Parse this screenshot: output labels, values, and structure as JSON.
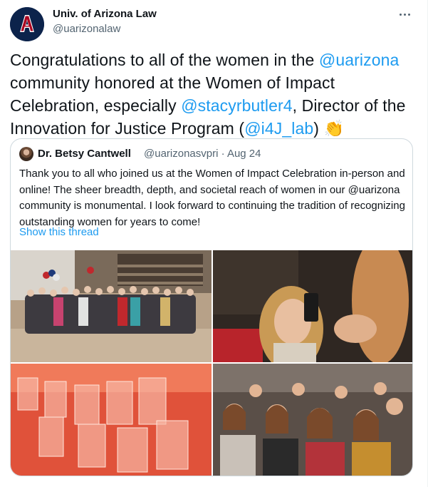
{
  "author": {
    "name": "Univ. of Arizona Law",
    "handle": "@uarizonalaw"
  },
  "tweet": {
    "text_1": "Congratulations to all of the women in the ",
    "mention_1": "@uarizona",
    "text_2": " community honored at the Women of Impact Celebration, especially ",
    "mention_2": "@stacyrbutler4",
    "text_3": ", Director of the Innovation for Justice Program (",
    "mention_3": "@i4J_lab",
    "text_4": ") ",
    "emoji": "👏"
  },
  "quoted": {
    "name": "Dr. Betsy Cantwell",
    "handle_date": "@uarizonasvpri · Aug 24",
    "text": "Thank you to all who joined us at the Women of Impact Celebration in-person and online! The sheer breadth, depth, and societal reach of women in our @uarizona community is monumental. I look forward to continuing the tradition of recognizing outstanding women for years to come!",
    "show_thread": "Show this thread"
  },
  "colors": {
    "link": "#1d9bf0",
    "secondary_text": "#536471",
    "border": "#cfd9de",
    "brand_navy": "#0c234b",
    "brand_red": "#ab0520"
  },
  "icons": {
    "more": "more-horizontal-icon",
    "avatar": "arizona-block-a-logo"
  }
}
